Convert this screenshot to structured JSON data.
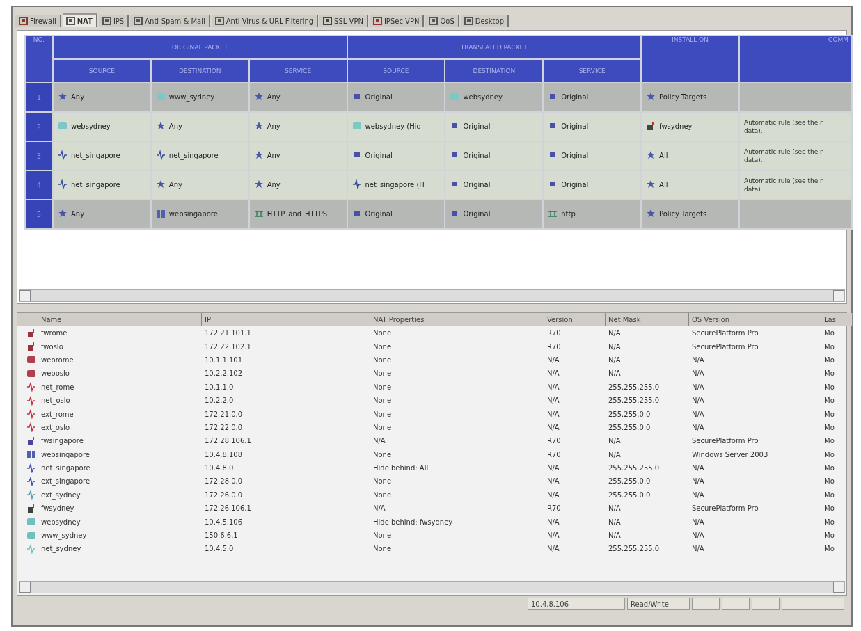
{
  "tabs": [
    {
      "label": "Firewall",
      "kind": "shield",
      "selected": false
    },
    {
      "label": "NAT",
      "kind": "nat",
      "selected": true
    },
    {
      "label": "IPS",
      "kind": "ips",
      "selected": false
    },
    {
      "label": "Anti-Spam & Mail",
      "kind": "mail",
      "selected": false
    },
    {
      "label": "Anti-Virus & URL Filtering",
      "kind": "search",
      "selected": false
    },
    {
      "label": "SSL VPN",
      "kind": "ssl",
      "selected": false
    },
    {
      "label": "IPSec VPN",
      "kind": "lock",
      "selected": false
    },
    {
      "label": "QoS",
      "kind": "qos",
      "selected": false
    },
    {
      "label": "Desktop",
      "kind": "desktop",
      "selected": false
    }
  ],
  "rule_table": {
    "number_header": "NO.",
    "groups": [
      {
        "label": "ORIGINAL PACKET",
        "columns": [
          "SOURCE",
          "DESTINATION",
          "SERVICE"
        ]
      },
      {
        "label": "TRANSLATED PACKET",
        "columns": [
          "SOURCE",
          "DESTINATION",
          "SERVICE"
        ]
      }
    ],
    "install_on": "INSTALL ON",
    "comments": "COMM",
    "rows": [
      {
        "number": "1",
        "kind": "manual",
        "cells": [
          {
            "kind": "any",
            "text": "Any"
          },
          {
            "kind": "host",
            "text": "www_sydney"
          },
          {
            "kind": "any",
            "text": "Any"
          },
          {
            "kind": "original",
            "text": "Original"
          },
          {
            "kind": "host",
            "text": "websydney"
          },
          {
            "kind": "original",
            "text": "Original"
          },
          {
            "kind": "any",
            "text": "Policy Targets"
          }
        ]
      },
      {
        "number": "2",
        "kind": "automatic",
        "cells": [
          {
            "kind": "host",
            "text": "websydney"
          },
          {
            "kind": "any",
            "text": "Any"
          },
          {
            "kind": "any",
            "text": "Any"
          },
          {
            "kind": "host",
            "text": "websydney (Hid"
          },
          {
            "kind": "original",
            "text": "Original"
          },
          {
            "kind": "original",
            "text": "Original"
          },
          {
            "kind": "gateway",
            "text": "fwsydney"
          }
        ],
        "comment": "Automatic rule (see the n data)."
      },
      {
        "number": "3",
        "kind": "automatic",
        "cells": [
          {
            "kind": "network",
            "text": "net_singapore"
          },
          {
            "kind": "network",
            "text": "net_singapore"
          },
          {
            "kind": "any",
            "text": "Any"
          },
          {
            "kind": "original",
            "text": "Original"
          },
          {
            "kind": "original",
            "text": "Original"
          },
          {
            "kind": "original",
            "text": "Original"
          },
          {
            "kind": "any",
            "text": "All"
          }
        ],
        "comment": "Automatic rule (see the n data)."
      },
      {
        "number": "4",
        "kind": "automatic",
        "cells": [
          {
            "kind": "network",
            "text": "net_singapore"
          },
          {
            "kind": "any",
            "text": "Any"
          },
          {
            "kind": "any",
            "text": "Any"
          },
          {
            "kind": "network",
            "text": "net_singapore (H"
          },
          {
            "kind": "original",
            "text": "Original"
          },
          {
            "kind": "original",
            "text": "Original"
          },
          {
            "kind": "any",
            "text": "All"
          }
        ],
        "comment": "Automatic rule (see the n data)."
      },
      {
        "number": "5",
        "kind": "manual",
        "cells": [
          {
            "kind": "any",
            "text": "Any"
          },
          {
            "kind": "server",
            "text": "websingapore"
          },
          {
            "kind": "service",
            "text": "HTTP_and_HTTPS"
          },
          {
            "kind": "original",
            "text": "Original"
          },
          {
            "kind": "original",
            "text": "Original"
          },
          {
            "kind": "service",
            "text": "http"
          },
          {
            "kind": "any",
            "text": "Policy Targets"
          }
        ]
      }
    ]
  },
  "objects": {
    "columns": [
      "Name",
      "IP",
      "NAT Properties",
      "Version",
      "Net Mask",
      "OS Version",
      "Las"
    ],
    "rows": [
      {
        "kind": "gateway",
        "color": "#9a3040",
        "cells": [
          "fwrome",
          "172.21.101.1",
          "None",
          "R70",
          "N/A",
          "SecurePlatform Pro",
          "Mo"
        ]
      },
      {
        "kind": "gateway",
        "color": "#9a3040",
        "cells": [
          "fwoslo",
          "172.22.102.1",
          "None",
          "R70",
          "N/A",
          "SecurePlatform Pro",
          "Mo"
        ]
      },
      {
        "kind": "host",
        "color": "#b04050",
        "cells": [
          "webrome",
          "10.1.1.101",
          "None",
          "N/A",
          "N/A",
          "N/A",
          "Mo"
        ]
      },
      {
        "kind": "host",
        "color": "#b04050",
        "cells": [
          "weboslo",
          "10.2.2.102",
          "None",
          "N/A",
          "N/A",
          "N/A",
          "Mo"
        ]
      },
      {
        "kind": "network",
        "color": "#c03040",
        "cells": [
          "net_rome",
          "10.1.1.0",
          "None",
          "N/A",
          "255.255.255.0",
          "N/A",
          "Mo"
        ]
      },
      {
        "kind": "network",
        "color": "#c03040",
        "cells": [
          "net_oslo",
          "10.2.2.0",
          "None",
          "N/A",
          "255.255.255.0",
          "N/A",
          "Mo"
        ]
      },
      {
        "kind": "network",
        "color": "#c03040",
        "cells": [
          "ext_rome",
          "172.21.0.0",
          "None",
          "N/A",
          "255.255.0.0",
          "N/A",
          "Mo"
        ]
      },
      {
        "kind": "network",
        "color": "#c03040",
        "cells": [
          "ext_oslo",
          "172.22.0.0",
          "None",
          "N/A",
          "255.255.0.0",
          "N/A",
          "Mo"
        ]
      },
      {
        "kind": "gateway",
        "color": "#5040a0",
        "cells": [
          "fwsingapore",
          "172.28.106.1",
          "N/A",
          "R70",
          "N/A",
          "SecurePlatform Pro",
          "Mo"
        ]
      },
      {
        "kind": "server",
        "color": "#5060b0",
        "cells": [
          "websingapore",
          "10.4.8.108",
          "None",
          "R70",
          "N/A",
          "Windows Server 2003",
          "Mo"
        ]
      },
      {
        "kind": "network",
        "color": "#4050b0",
        "cells": [
          "net_singapore",
          "10.4.8.0",
          "Hide behind: All",
          "N/A",
          "255.255.255.0",
          "N/A",
          "Mo"
        ]
      },
      {
        "kind": "network",
        "color": "#4050b0",
        "cells": [
          "ext_singapore",
          "172.28.0.0",
          "None",
          "N/A",
          "255.255.0.0",
          "N/A",
          "Mo"
        ]
      },
      {
        "kind": "network",
        "color": "#50a0b0",
        "cells": [
          "ext_sydney",
          "172.26.0.0",
          "None",
          "N/A",
          "255.255.0.0",
          "N/A",
          "Mo"
        ]
      },
      {
        "kind": "gateway",
        "color": "#404040",
        "cells": [
          "fwsydney",
          "172.26.106.1",
          "N/A",
          "R70",
          "N/A",
          "SecurePlatform Pro",
          "Mo"
        ]
      },
      {
        "kind": "host",
        "color": "#70c0c0",
        "cells": [
          "websydney",
          "10.4.5.106",
          "Hide behind: fwsydney",
          "N/A",
          "N/A",
          "N/A",
          "Mo"
        ]
      },
      {
        "kind": "host",
        "color": "#70c0c0",
        "cells": [
          "www_sydney",
          "150.6.6.1",
          "None",
          "N/A",
          "N/A",
          "N/A",
          "Mo"
        ]
      },
      {
        "kind": "network",
        "color": "#70c0c0",
        "cells": [
          "net_sydney",
          "10.4.5.0",
          "None",
          "N/A",
          "255.255.255.0",
          "N/A",
          "Mo"
        ]
      }
    ]
  },
  "status_bar": [
    "10.4.8.106",
    "Read/Write"
  ]
}
